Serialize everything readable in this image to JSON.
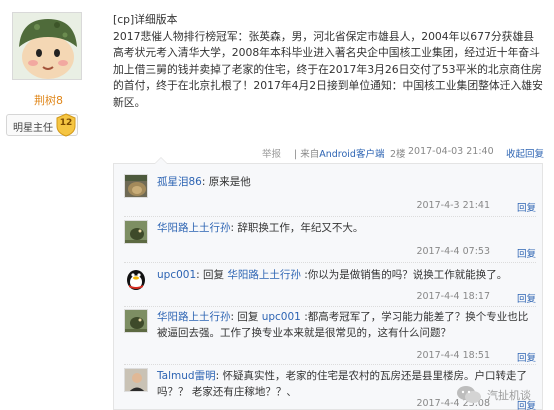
{
  "author": {
    "username": "荆树8",
    "rank_label": "明星主任",
    "rank_level": "12"
  },
  "post": {
    "title": "[cp]详细版本",
    "body": "2017悲催人物排行榜冠军：张英森，男，河北省保定市雄县人，2004年以677分获雄县高考状元考入清华大学，2008年本科毕业进入著名央企中国核工业集团，经过近十年奋斗加上借三舅的钱并卖掉了老家的住宅，终于在2017年3月26日交付了53平米的北京商住房的首付，终于在北京扎根了！2017年4月2日接到单位通知：中国核工业集团整体迁入雄安新区。",
    "meta": {
      "report": "举报",
      "from_prefix": "| 来自",
      "client": "Android客户端",
      "floor": "2楼",
      "time": "2017-04-03 21:40",
      "reply_label": "收起回复"
    }
  },
  "replies": [
    {
      "user": "孤星泪86",
      "text": ": 原来是他",
      "time": "2017-4-3 21:41",
      "reply_label": "回复"
    },
    {
      "user": "华阳路上土行孙",
      "text": ": 辞职换工作，年纪又不大。",
      "time": "2017-4-4 07:53",
      "reply_label": "回复"
    },
    {
      "user": "upc001",
      "prefix": ": 回复 ",
      "target": "华阳路上土行孙",
      "text": " :你以为是做销售的吗？说换工作就能换了。",
      "time": "2017-4-4 18:17",
      "reply_label": "回复"
    },
    {
      "user": "华阳路上土行孙",
      "prefix": ": 回复 ",
      "target": "upc001",
      "text": " :都高考冠军了，学习能力能差了？换个专业也比被逼回去强。工作了换专业本来就是很常见的，这有什么问题？",
      "time": "2017-4-4 18:51",
      "reply_label": "回复"
    },
    {
      "user": "Talmud雷明",
      "text": ": 怀疑真实性，老家的住宅是农村的瓦房还是县里楼房。户口转走了吗？？ 老家还有庄稼地？？、",
      "time": "2017-4-4 23:08",
      "reply_label": "回复"
    }
  ],
  "watermark": {
    "text": "汽扯机谈"
  }
}
